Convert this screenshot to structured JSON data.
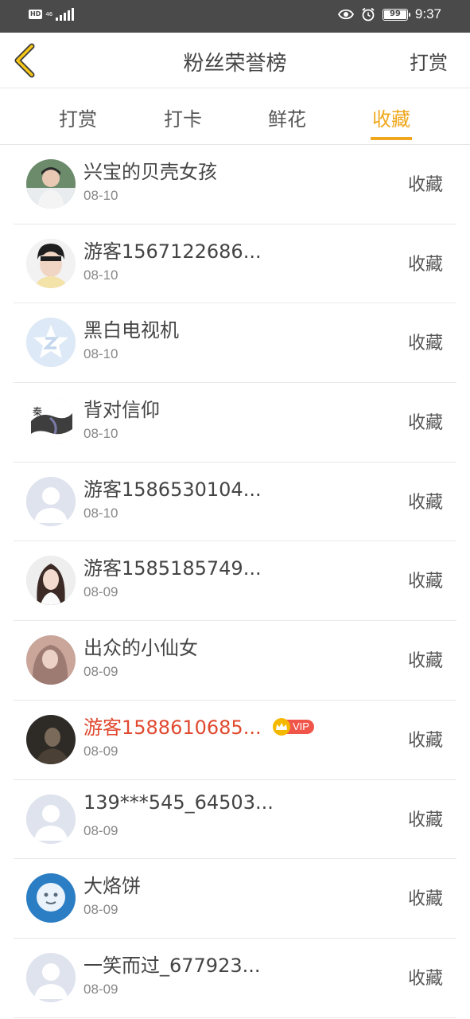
{
  "status_bar": {
    "hd": "HD",
    "network": "46",
    "battery": "99",
    "battery_fraction": 0.99,
    "time": "9:37"
  },
  "header": {
    "title": "粉丝荣誉榜",
    "right_action": "打赏"
  },
  "tabs": [
    {
      "label": "打赏",
      "active": false
    },
    {
      "label": "打卡",
      "active": false
    },
    {
      "label": "鲜花",
      "active": false
    },
    {
      "label": "收藏",
      "active": true
    }
  ],
  "accent_color": "#f0a71d",
  "vip_name_color": "#e0492f",
  "list": [
    {
      "name": "兴宝的贝壳女孩",
      "date": "08-10",
      "action": "收藏",
      "avatar": "photo-boy-white-shirt"
    },
    {
      "name": "游客1567122686...",
      "date": "08-10",
      "action": "收藏",
      "avatar": "photo-boy-portrait"
    },
    {
      "name": "黑白电视机",
      "date": "08-10",
      "action": "收藏",
      "avatar": "star-z-logo"
    },
    {
      "name": "背对信仰",
      "date": "08-10",
      "action": "收藏",
      "avatar": "ink-calligraphy"
    },
    {
      "name": "游客1586530104...",
      "date": "08-10",
      "action": "收藏",
      "avatar": "default-user"
    },
    {
      "name": "游客1585185749...",
      "date": "08-09",
      "action": "收藏",
      "avatar": "photo-girl-long-hair"
    },
    {
      "name": "出众的小仙女",
      "date": "08-09",
      "action": "收藏",
      "avatar": "photo-girl-soft"
    },
    {
      "name": "游客1588610685...",
      "date": "08-09",
      "action": "收藏",
      "avatar": "photo-dark-portrait",
      "vip": "VIP"
    },
    {
      "name": "139***545_64503...",
      "date": "08-09",
      "action": "收藏",
      "avatar": "default-user"
    },
    {
      "name": "大烙饼",
      "date": "08-09",
      "action": "收藏",
      "avatar": "cartoon-blue"
    },
    {
      "name": "一笑而过_677923...",
      "date": "08-09",
      "action": "收藏",
      "avatar": "default-user"
    }
  ]
}
